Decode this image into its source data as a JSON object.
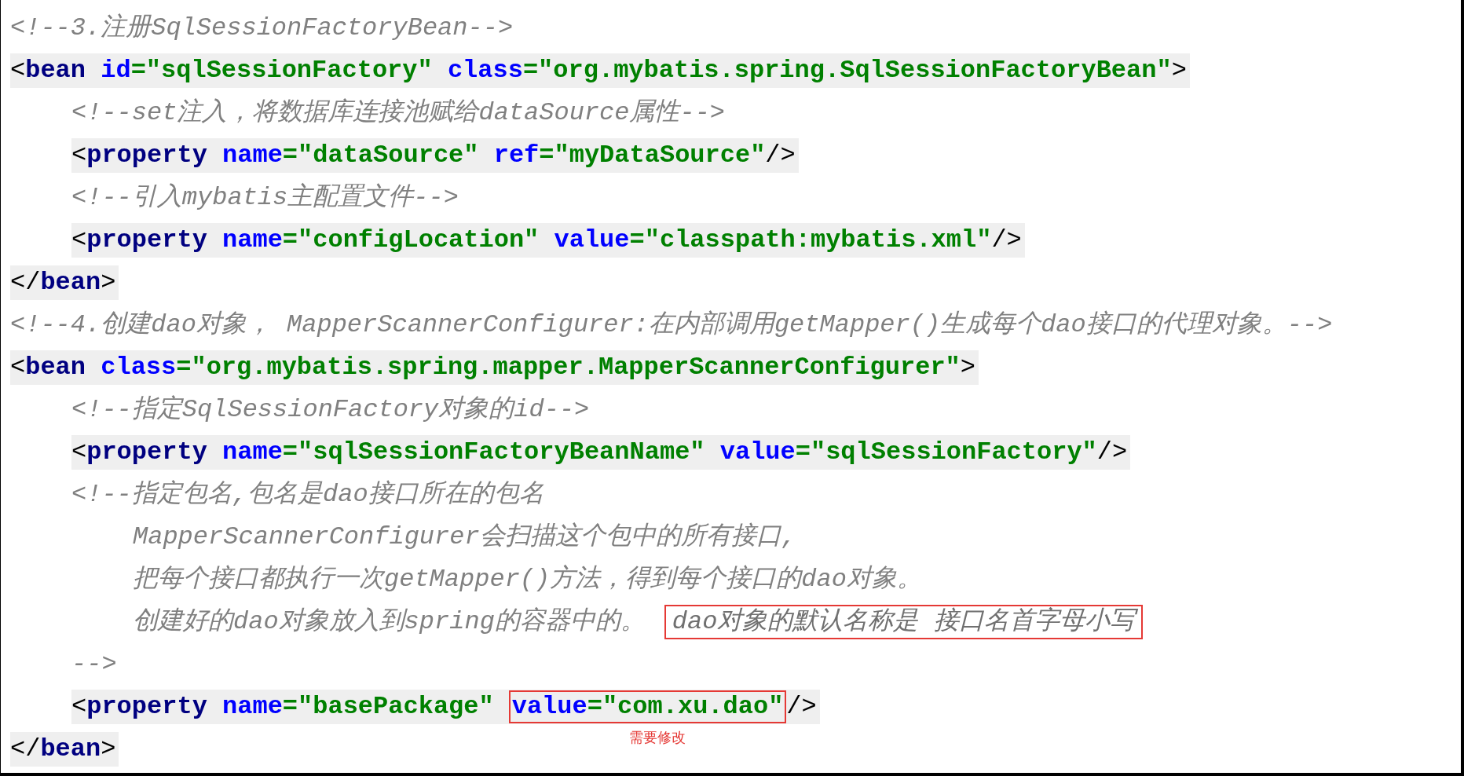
{
  "code": [
    {
      "kind": "comment",
      "lines": [
        {
          "text": "<!--3.注册SqlSessionFactoryBean-->"
        }
      ]
    },
    {
      "kind": "element",
      "open": [
        {
          "kind": "punct",
          "text": "<"
        },
        {
          "kind": "tag",
          "text": "bean"
        },
        {
          "kind": "attr",
          "text": " id"
        },
        {
          "kind": "value",
          "text": "=\"sqlSessionFactory\""
        },
        {
          "kind": "attr",
          "text": " class"
        },
        {
          "kind": "value",
          "text": "=\"org.mybatis.spring.SqlSessionFactoryBean\""
        },
        {
          "kind": "punct",
          "text": ">"
        }
      ],
      "children": [
        {
          "kind": "comment",
          "lines": [
            {
              "text": "<!--set注入，将数据库连接池赋给dataSource属性-->"
            }
          ]
        },
        {
          "kind": "element",
          "open": [
            {
              "kind": "punct",
              "text": "<"
            },
            {
              "kind": "tag",
              "text": "property"
            },
            {
              "kind": "attr",
              "text": " name"
            },
            {
              "kind": "value",
              "text": "=\"dataSource\""
            },
            {
              "kind": "attr",
              "text": " ref"
            },
            {
              "kind": "value",
              "text": "=\"myDataSource\""
            },
            {
              "kind": "punct",
              "text": "/>"
            }
          ]
        },
        {
          "kind": "comment",
          "lines": [
            {
              "text": "<!--引入mybatis主配置文件-->"
            }
          ]
        },
        {
          "kind": "element",
          "open": [
            {
              "kind": "punct",
              "text": "<"
            },
            {
              "kind": "tag",
              "text": "property"
            },
            {
              "kind": "attr",
              "text": " name"
            },
            {
              "kind": "value",
              "text": "=\"configLocation\""
            },
            {
              "kind": "attr",
              "text": " value"
            },
            {
              "kind": "value",
              "text": "=\"classpath:mybatis.xml\""
            },
            {
              "kind": "punct",
              "text": "/>"
            }
          ]
        }
      ],
      "close": [
        {
          "kind": "punct",
          "text": "</"
        },
        {
          "kind": "tag",
          "text": "bean"
        },
        {
          "kind": "punct",
          "text": ">"
        }
      ]
    },
    {
      "kind": "comment",
      "lines": [
        {
          "text": "<!--4.创建dao对象， MapperScannerConfigurer:在内部调用getMapper()生成每个dao接口的代理对象。-->"
        }
      ]
    },
    {
      "kind": "element",
      "open": [
        {
          "kind": "punct",
          "text": "<"
        },
        {
          "kind": "tag",
          "text": "bean"
        },
        {
          "kind": "attr",
          "text": " class"
        },
        {
          "kind": "value",
          "text": "=\"org.mybatis.spring.mapper.MapperScannerConfigurer\""
        },
        {
          "kind": "punct",
          "text": ">"
        }
      ],
      "children": [
        {
          "kind": "comment",
          "lines": [
            {
              "text": "<!--指定SqlSessionFactory对象的id-->"
            }
          ]
        },
        {
          "kind": "element",
          "open": [
            {
              "kind": "punct",
              "text": "<"
            },
            {
              "kind": "tag",
              "text": "property"
            },
            {
              "kind": "attr",
              "text": " name"
            },
            {
              "kind": "value",
              "text": "=\"sqlSessionFactoryBeanName\""
            },
            {
              "kind": "attr",
              "text": " value"
            },
            {
              "kind": "value",
              "text": "=\"sqlSessionFactory\""
            },
            {
              "kind": "punct",
              "text": "/>"
            }
          ]
        },
        {
          "kind": "comment",
          "lines": [
            {
              "text": "<!--指定包名,包名是dao接口所在的包名",
              "children": [
                {
                  "text": "MapperScannerConfigurer会扫描这个包中的所有接口,"
                },
                {
                  "text": "把每个接口都执行一次getMapper()方法，得到每个接口的dao对象。"
                },
                {
                  "text": "创建好的dao对象放入到spring的容器中的。",
                  "boxed": "dao对象的默认名称是 接口名首字母小写"
                }
              ]
            },
            {
              "text": "-->"
            }
          ]
        },
        {
          "kind": "element",
          "open": [
            {
              "kind": "punct",
              "text": "<"
            },
            {
              "kind": "tag",
              "text": "property"
            },
            {
              "kind": "attr",
              "text": " name"
            },
            {
              "kind": "value",
              "text": "=\"basePackage\"",
              "boxed": false
            },
            {
              "kind": "attr",
              "text": "value",
              "boxed": true
            },
            {
              "kind": "value",
              "text": "=\"com.xu.dao\"",
              "boxed": true,
              "note": "需要修改"
            },
            {
              "kind": "punct",
              "text": "/>"
            }
          ]
        }
      ],
      "close": [
        {
          "kind": "punct",
          "text": "</"
        },
        {
          "kind": "tag",
          "text": "bean"
        },
        {
          "kind": "punct",
          "text": ">"
        }
      ]
    }
  ]
}
